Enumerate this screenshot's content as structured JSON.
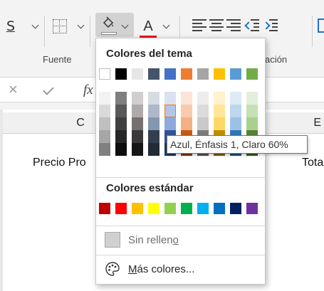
{
  "ribbon": {
    "underline_label": "S",
    "font_color_label": "A",
    "font_color": "#e81123",
    "group_font_label": "Fuente",
    "group_alignment_label_partial": "ación"
  },
  "formula_bar": {
    "cancel_label": "×",
    "fx_label": "fx"
  },
  "sheet": {
    "columns": [
      {
        "label": "C"
      },
      {
        "label": "E"
      }
    ],
    "cells": {
      "c_header_text": "Precio Pro",
      "e_header_text": "Tota"
    }
  },
  "fill_color_menu": {
    "theme_heading": "Colores del tema",
    "theme_colors": [
      "#ffffff",
      "#000000",
      "#e7e6e6",
      "#44546a",
      "#4472c4",
      "#ed7d31",
      "#a5a5a5",
      "#ffc000",
      "#5b9bd5",
      "#70ad47"
    ],
    "theme_shades": [
      [
        "#f2f2f2",
        "#d9d9d9",
        "#bfbfbf",
        "#a6a6a6",
        "#808080"
      ],
      [
        "#7f7f7f",
        "#595959",
        "#404040",
        "#262626",
        "#0d0d0d"
      ],
      [
        "#d0cece",
        "#aeaaaa",
        "#757171",
        "#3a3838",
        "#171616"
      ],
      [
        "#d6dce4",
        "#adb9ca",
        "#8497b0",
        "#333f4f",
        "#222b35"
      ],
      [
        "#d9e1f2",
        "#b4c6e7",
        "#8ea9db",
        "#305496",
        "#203764"
      ],
      [
        "#fce4d6",
        "#f8cbad",
        "#f4b084",
        "#c65911",
        "#833c0c"
      ],
      [
        "#ededed",
        "#dbdbdb",
        "#c9c9c9",
        "#7b7b7b",
        "#525252"
      ],
      [
        "#fff2cc",
        "#ffe699",
        "#ffd966",
        "#bf8f00",
        "#806000"
      ],
      [
        "#ddebf7",
        "#bdd7ee",
        "#9bc2e6",
        "#2f75b5",
        "#1f4e78"
      ],
      [
        "#e2efda",
        "#c6e0b4",
        "#a9d08e",
        "#548235",
        "#375623"
      ]
    ],
    "selected_shade": {
      "column": 4,
      "row": 1
    },
    "standard_heading": "Colores estándar",
    "standard_colors": [
      "#c00000",
      "#ff0000",
      "#ffc000",
      "#ffff00",
      "#92d050",
      "#00b050",
      "#00b0f0",
      "#0070c0",
      "#002060",
      "#7030a0"
    ],
    "no_fill_label_pre": "Sin rellen",
    "no_fill_label_u": "o",
    "more_colors_label_u": "M",
    "more_colors_label_rest": "ás colores..."
  },
  "tooltip": {
    "text": "Azul, Énfasis 1, Claro 60%"
  }
}
